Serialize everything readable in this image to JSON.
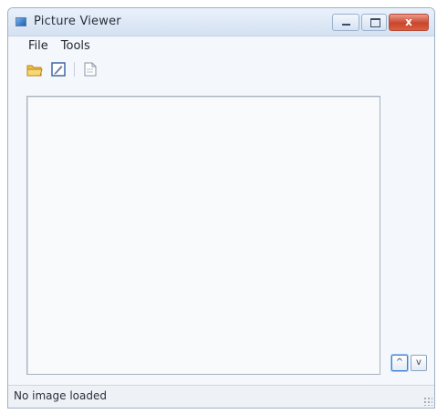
{
  "window": {
    "title": "Picture Viewer",
    "caption_buttons": {
      "minimize_icon": "minimize-icon",
      "maximize_icon": "maximize-icon",
      "close_icon": "close-icon",
      "close_glyph": "x"
    }
  },
  "menu": {
    "items": [
      {
        "label": "File"
      },
      {
        "label": "Tools"
      }
    ]
  },
  "toolbar": {
    "buttons": [
      {
        "icon": "open-folder-icon"
      },
      {
        "icon": "edit-icon"
      },
      {
        "icon": "document-icon"
      }
    ]
  },
  "canvas": {
    "state": "empty"
  },
  "side_buttons": [
    {
      "icon": "up-icon",
      "glyph": "^",
      "active": true
    },
    {
      "icon": "down-icon",
      "glyph": "v",
      "active": false
    }
  ],
  "status": {
    "text": "No image loaded"
  },
  "colors": {
    "titlebar": "#d4e1f1",
    "close_button": "#c9462d",
    "window_bg": "#f4f7fb",
    "canvas_bg": "#f8fafb"
  }
}
